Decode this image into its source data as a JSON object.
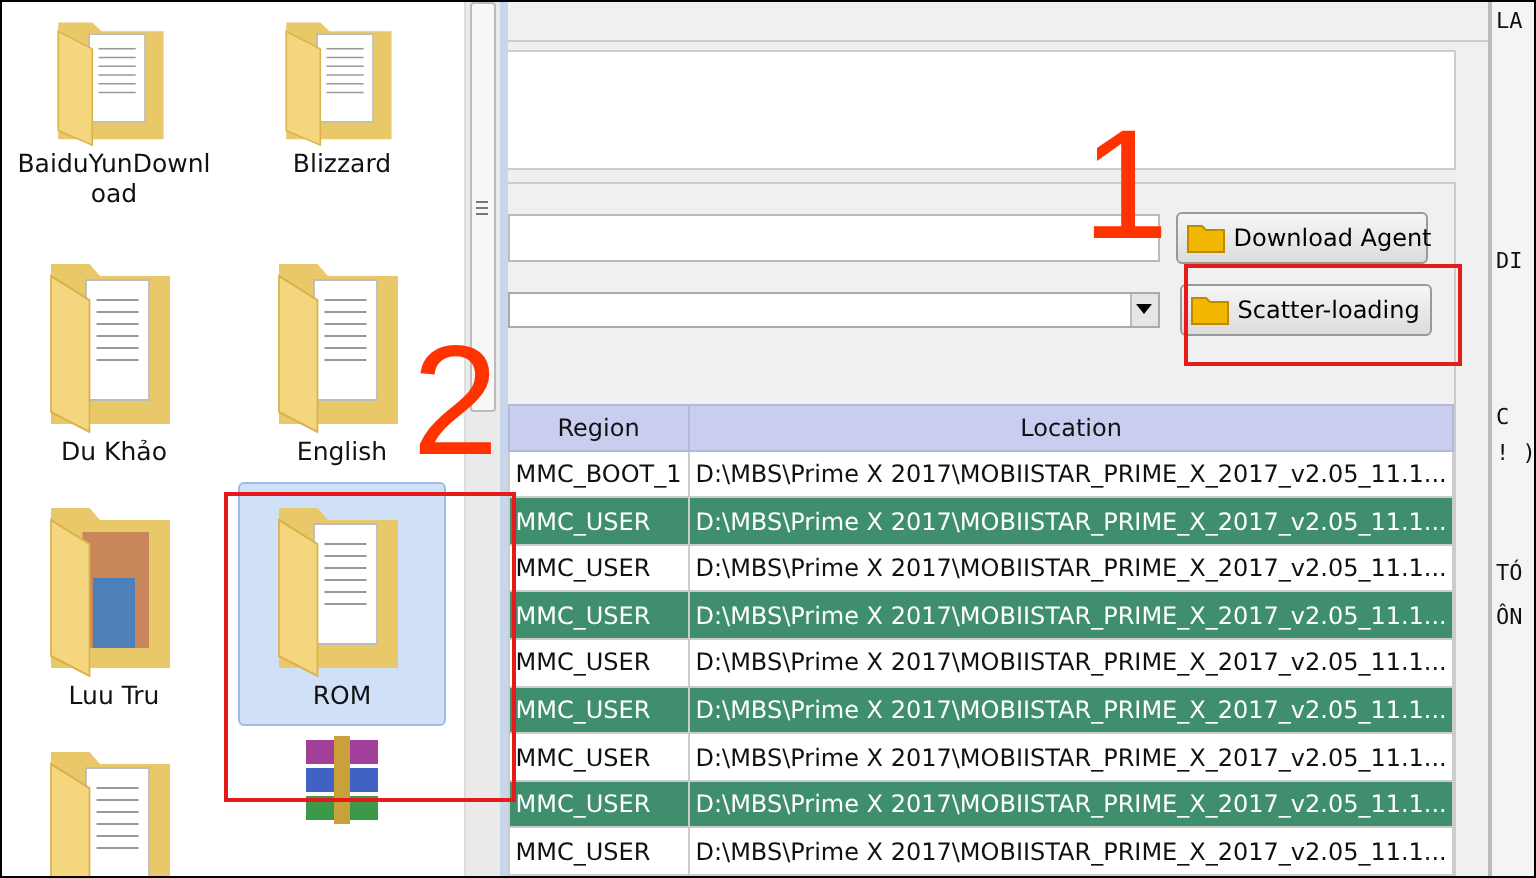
{
  "explorer": {
    "items": [
      {
        "label": "BaiduYunDownload",
        "kind": "folder",
        "selected": false
      },
      {
        "label": "Blizzard",
        "kind": "folder",
        "selected": false
      },
      {
        "label": "Du Khảo",
        "kind": "folder",
        "selected": false
      },
      {
        "label": "English",
        "kind": "folder",
        "selected": false
      },
      {
        "label": "Luu Tru",
        "kind": "photo-folder",
        "selected": false
      },
      {
        "label": "ROM",
        "kind": "folder",
        "selected": true
      },
      {
        "kind": "folder",
        "selected": false
      },
      {
        "kind": "archive",
        "selected": false
      }
    ]
  },
  "flash_tool": {
    "buttons": [
      "Download Agent",
      "Scatter-loading"
    ],
    "table": {
      "columns": [
        "Region",
        "Location"
      ],
      "rows": [
        {
          "region": "MMC_BOOT_1",
          "location": "D:\\MBS\\Prime X 2017\\MOBIISTAR_PRIME_X_2017_v2.05_11.1...",
          "selected": false
        },
        {
          "region": "MMC_USER",
          "location": "D:\\MBS\\Prime X 2017\\MOBIISTAR_PRIME_X_2017_v2.05_11.1...",
          "selected": true
        },
        {
          "region": "MMC_USER",
          "location": "D:\\MBS\\Prime X 2017\\MOBIISTAR_PRIME_X_2017_v2.05_11.1...",
          "selected": false
        },
        {
          "region": "MMC_USER",
          "location": "D:\\MBS\\Prime X 2017\\MOBIISTAR_PRIME_X_2017_v2.05_11.1...",
          "selected": true
        },
        {
          "region": "MMC_USER",
          "location": "D:\\MBS\\Prime X 2017\\MOBIISTAR_PRIME_X_2017_v2.05_11.1...",
          "selected": false
        },
        {
          "region": "MMC_USER",
          "location": "D:\\MBS\\Prime X 2017\\MOBIISTAR_PRIME_X_2017_v2.05_11.1...",
          "selected": true
        },
        {
          "region": "MMC_USER",
          "location": "D:\\MBS\\Prime X 2017\\MOBIISTAR_PRIME_X_2017_v2.05_11.1...",
          "selected": false
        },
        {
          "region": "MMC_USER",
          "location": "D:\\MBS\\Prime X 2017\\MOBIISTAR_PRIME_X_2017_v2.05_11.1...",
          "selected": true
        },
        {
          "region": "MMC_USER",
          "location": "D:\\MBS\\Prime X 2017\\MOBIISTAR_PRIME_X_2017_v2.05_11.1...",
          "selected": false
        }
      ]
    }
  },
  "side_fragments": [
    "LA",
    "DI",
    "C",
    "! )",
    "TÓ",
    "ÔN"
  ],
  "annotations": [
    {
      "label": "1"
    },
    {
      "label": "2"
    }
  ]
}
